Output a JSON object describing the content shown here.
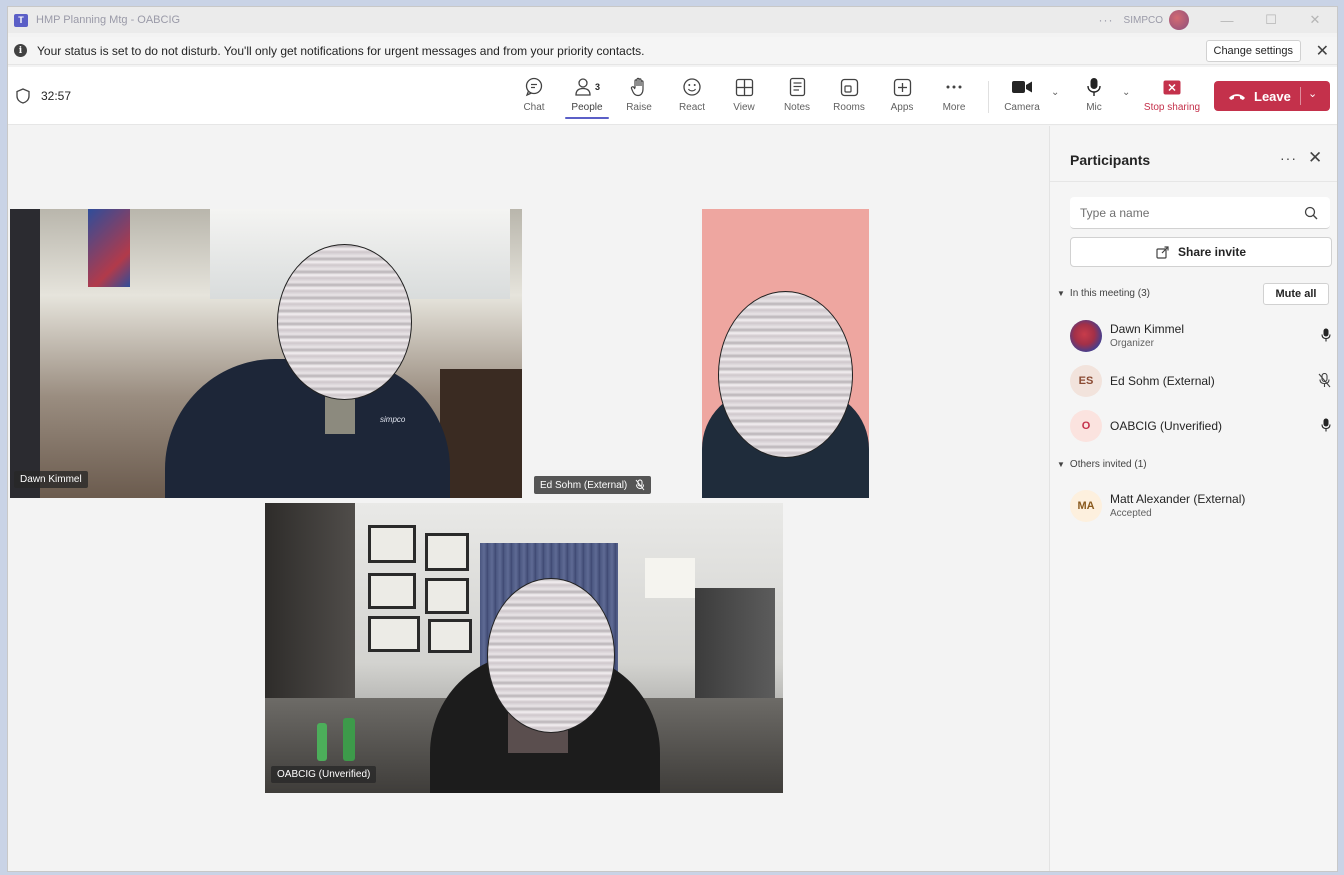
{
  "window": {
    "title": "HMP Planning Mtg - OABCIG",
    "org_name": "SIMPCO"
  },
  "notification": {
    "text": "Your status is set to do not disturb. You'll only get notifications for urgent messages and from your priority contacts.",
    "button": "Change settings"
  },
  "toolbar": {
    "timer": "32:57",
    "people_count": "3",
    "items": [
      {
        "label": "Chat",
        "icon": "chat-icon"
      },
      {
        "label": "People",
        "icon": "people-icon"
      },
      {
        "label": "Raise",
        "icon": "hand-icon"
      },
      {
        "label": "React",
        "icon": "smile-icon"
      },
      {
        "label": "View",
        "icon": "grid-icon"
      },
      {
        "label": "Notes",
        "icon": "notes-icon"
      },
      {
        "label": "Rooms",
        "icon": "rooms-icon"
      },
      {
        "label": "Apps",
        "icon": "apps-icon"
      },
      {
        "label": "More",
        "icon": "more-icon"
      },
      {
        "label": "Camera",
        "icon": "camera-icon"
      },
      {
        "label": "Mic",
        "icon": "mic-icon"
      },
      {
        "label": "Stop sharing",
        "icon": "stop-share-icon"
      }
    ],
    "leave_label": "Leave",
    "active_item": "People",
    "colors": {
      "accent": "#5b5fc7",
      "leave": "#c4314b"
    }
  },
  "stage": {
    "tiles": [
      {
        "name": "Dawn Kimmel",
        "shirt_logo": "simpco"
      },
      {
        "name": "Ed Sohm (External)",
        "muted": true
      },
      {
        "name": "OABCIG (Unverified)"
      }
    ]
  },
  "panel": {
    "title": "Participants",
    "search_placeholder": "Type a name",
    "share_label": "Share invite",
    "in_meeting_label": "In this meeting (3)",
    "mute_all_label": "Mute all",
    "in_meeting": [
      {
        "name": "Dawn Kimmel",
        "role": "Organizer",
        "initials": "",
        "mic": "on"
      },
      {
        "name": "Ed Sohm (External)",
        "role": "",
        "initials": "ES",
        "mic": "muted"
      },
      {
        "name": "OABCIG (Unverified)",
        "role": "",
        "initials": "O",
        "mic": "on"
      }
    ],
    "others_label": "Others invited (1)",
    "others": [
      {
        "name": "Matt Alexander (External)",
        "role": "Accepted",
        "initials": "MA"
      }
    ]
  }
}
